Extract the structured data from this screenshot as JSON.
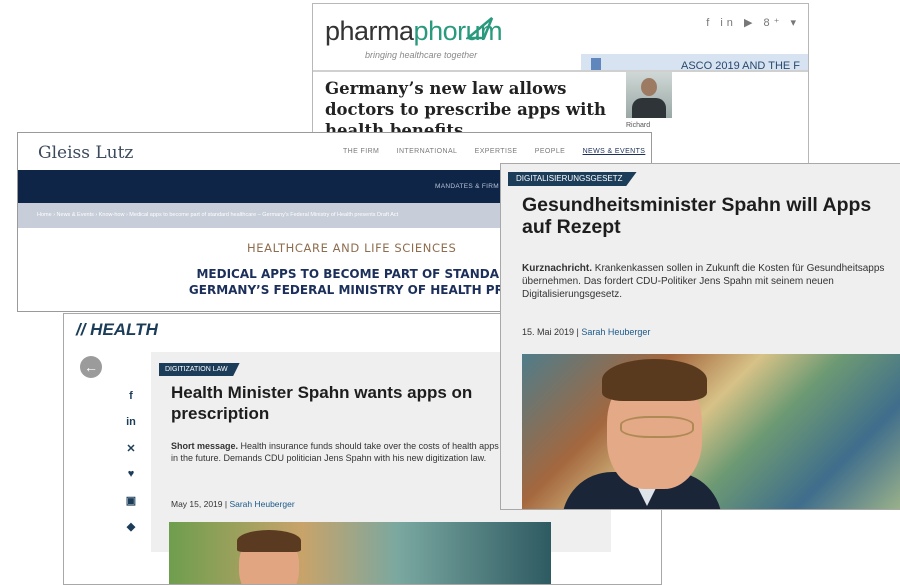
{
  "pharmaphorum": {
    "logo_main": "pharma",
    "logo_accent": "phorum",
    "tagline": "bringing healthcare together",
    "social": "f in ▶ 8⁺ ▾",
    "banner": "ASCO 2019 AND THE F",
    "headline": "Germany’s new law allows doctors to prescribe apps with health benefits",
    "author": "Richard"
  },
  "gleiss_lutz": {
    "brand": "Gleiss Lutz",
    "nav": [
      "THE FIRM",
      "INTERNATIONAL",
      "EXPERTISE",
      "PEOPLE",
      "NEWS & EVENTS"
    ],
    "darkbar": "MANDATES & FIRM",
    "breadcrumb": "Home › News & Events › Know-how › Medical apps to become part of standard healthcare – Germany's Federal Ministry of Health presents Draft Act",
    "section": "HEALTHCARE AND LIFE SCIENCES",
    "title_line1": "MEDICAL APPS TO BECOME PART OF STANDARD HEALTHCARE –",
    "title_line2": "GERMANY’S FEDERAL MINISTRY OF HEALTH PRESENTS DRAFT AC"
  },
  "english": {
    "section_title": "// HEALTH",
    "back": "←",
    "share": [
      "f",
      "in",
      "✕",
      "♥",
      "▣",
      "◆"
    ],
    "badge": "DIGITIZATION LAW",
    "headline": "Health Minister Spahn wants apps on prescription",
    "summary_lead": "Short message.",
    "summary_body": " Health insurance funds should take over the costs of health apps in the future. Demands CDU politician Jens Spahn with his new digitization law.",
    "date": "May 15, 2019 | ",
    "author": "Sarah Heuberger"
  },
  "german": {
    "badge": "DIGITALISIERUNGSGESETZ",
    "headline": "Gesundheitsminister Spahn will Apps auf Rezept",
    "summary_lead": "Kurznachricht.",
    "summary_body": " Krankenkassen sollen in Zukunft die Kosten für Gesundheitsapps übernehmen. Das fordert CDU-Politiker Jens Spahn mit seinem neuen Digitalisierungsgesetz.",
    "date": "15. Mai 2019 | ",
    "author": "Sarah Heuberger"
  }
}
